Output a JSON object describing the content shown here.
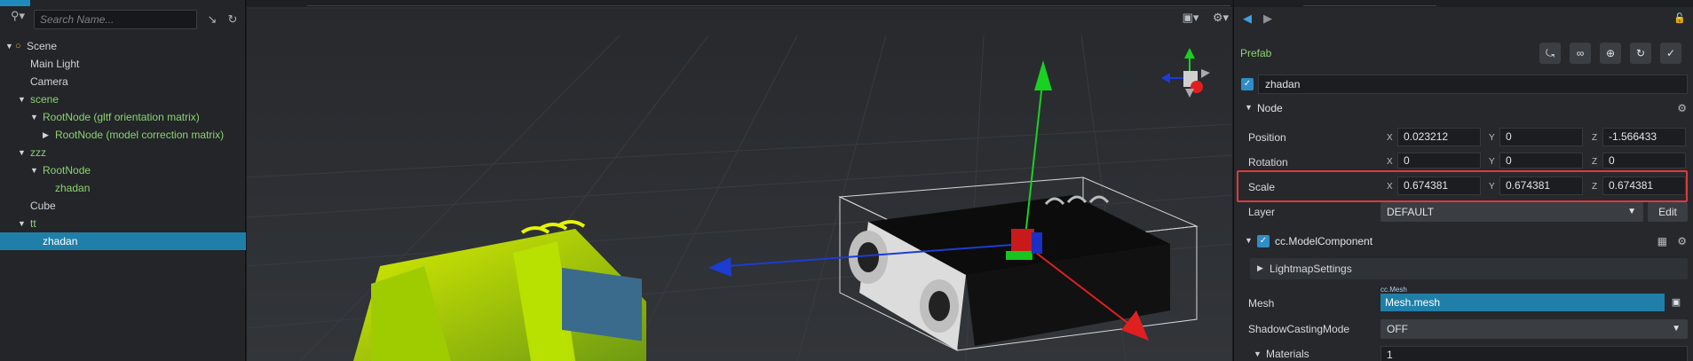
{
  "hierarchy": {
    "search_placeholder": "Search Name...",
    "tree": [
      {
        "label": "Scene",
        "depth": 0,
        "arrow": "open",
        "prefab": false,
        "icon": "flame-icon"
      },
      {
        "label": "Main Light",
        "depth": 1,
        "arrow": "none",
        "prefab": false
      },
      {
        "label": "Camera",
        "depth": 1,
        "arrow": "none",
        "prefab": false
      },
      {
        "label": "scene",
        "depth": 1,
        "arrow": "open",
        "prefab": true
      },
      {
        "label": "RootNode (gltf orientation matrix)",
        "depth": 2,
        "arrow": "open",
        "prefab": true
      },
      {
        "label": "RootNode (model correction matrix)",
        "depth": 3,
        "arrow": "closed",
        "prefab": true
      },
      {
        "label": "zzz",
        "depth": 1,
        "arrow": "open",
        "prefab": true
      },
      {
        "label": "RootNode",
        "depth": 2,
        "arrow": "open",
        "prefab": true
      },
      {
        "label": "zhadan",
        "depth": 3,
        "arrow": "none",
        "prefab": true
      },
      {
        "label": "Cube",
        "depth": 1,
        "arrow": "none",
        "prefab": false
      },
      {
        "label": "tt",
        "depth": 1,
        "arrow": "open",
        "prefab": true
      },
      {
        "label": "zhadan",
        "depth": 2,
        "arrow": "none",
        "prefab": true,
        "selected": true
      }
    ]
  },
  "inspector": {
    "prefab_label": "Prefab",
    "node_name": "zhadan",
    "node_section": "Node",
    "position": {
      "label": "Position",
      "x": "0.023212",
      "y": "0",
      "z": "-1.566433"
    },
    "rotation": {
      "label": "Rotation",
      "x": "0",
      "y": "0",
      "z": "0"
    },
    "scale": {
      "label": "Scale",
      "x": "0.674381",
      "y": "0.674381",
      "z": "0.674381"
    },
    "axes": {
      "x": "X",
      "y": "Y",
      "z": "Z"
    },
    "layer": {
      "label": "Layer",
      "value": "DEFAULT",
      "edit": "Edit"
    },
    "component": "cc.ModelComponent",
    "lightmap": "LightmapSettings",
    "mesh": {
      "label": "Mesh",
      "tag": "cc.Mesh",
      "value": "Mesh.mesh"
    },
    "shadow": {
      "label": "ShadowCastingMode",
      "value": "OFF"
    },
    "materials": {
      "label": "Materials",
      "value": "1"
    }
  },
  "colors": {
    "accent": "#1f7fa8",
    "prefab_green": "#8ad36f",
    "highlight_red": "#e0383a"
  }
}
